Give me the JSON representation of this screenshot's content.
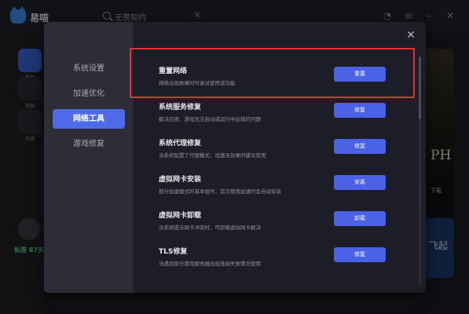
{
  "app": {
    "brand": "易喵",
    "search_text": "无畏契约",
    "search_clear": "✕",
    "sidebar": [
      {
        "label": "首页"
      },
      {
        "label": "电脑"
      },
      {
        "label": "手游"
      }
    ],
    "sign_days": "私签 87天",
    "right_panel": {
      "text1": "PH",
      "text2": "下载",
      "text3": "飞起"
    }
  },
  "dialog": {
    "close": "✕",
    "nav": [
      {
        "label": "系统设置",
        "active": false
      },
      {
        "label": "加速优化",
        "active": false
      },
      {
        "label": "网络工具",
        "active": true
      },
      {
        "label": "游戏修复",
        "active": false
      }
    ],
    "tools": [
      {
        "title": "重置网络",
        "desc": "网络出现故障时可尝试使用该功能",
        "button": "重置"
      },
      {
        "title": "系统服务修复",
        "desc": "解决应用、游戏无法启动或运行中出错的问题",
        "button": "修复"
      },
      {
        "title": "系统代理修复",
        "desc": "当系统配置了代理模式，加速无效果时建议使用",
        "button": "修复"
      },
      {
        "title": "虚拟网卡安装",
        "desc": "部分加速模式的基本组件，首次使用加速时会自动安装",
        "button": "安装"
      },
      {
        "title": "虚拟网卡卸载",
        "desc": "当系统提示网卡冲突时，可卸载虚拟网卡解决",
        "button": "卸载"
      },
      {
        "title": "TLS修复",
        "desc": "当遇到部分游戏服务器出现连接失败情况使用",
        "button": "修复"
      }
    ],
    "highlight_color": "#e3332f",
    "accent_color": "#4a62e6"
  }
}
